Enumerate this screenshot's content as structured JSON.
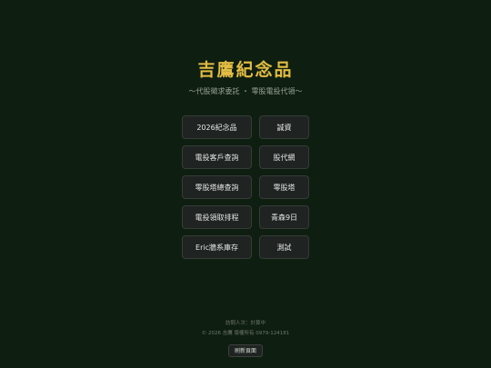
{
  "header": {
    "title": "吉鷹紀念品",
    "subtitle": "〜代股徵求委託 ・ 零股電投代領〜"
  },
  "buttons": [
    {
      "label": "2026紀念品"
    },
    {
      "label": "誠資"
    },
    {
      "label": "電投客戶查詢"
    },
    {
      "label": "股代網"
    },
    {
      "label": "零股塔總查詢"
    },
    {
      "label": "零股塔"
    },
    {
      "label": "電投領取排程"
    },
    {
      "label": "青森9日"
    },
    {
      "label": "Eric牆系庫存"
    },
    {
      "label": "測試"
    }
  ],
  "footer": {
    "visitors": "訪問人次：計算中",
    "copyright": "© 2026 吉鷹 版權所有 0979-124181",
    "refresh_label": "刷新頁面"
  }
}
